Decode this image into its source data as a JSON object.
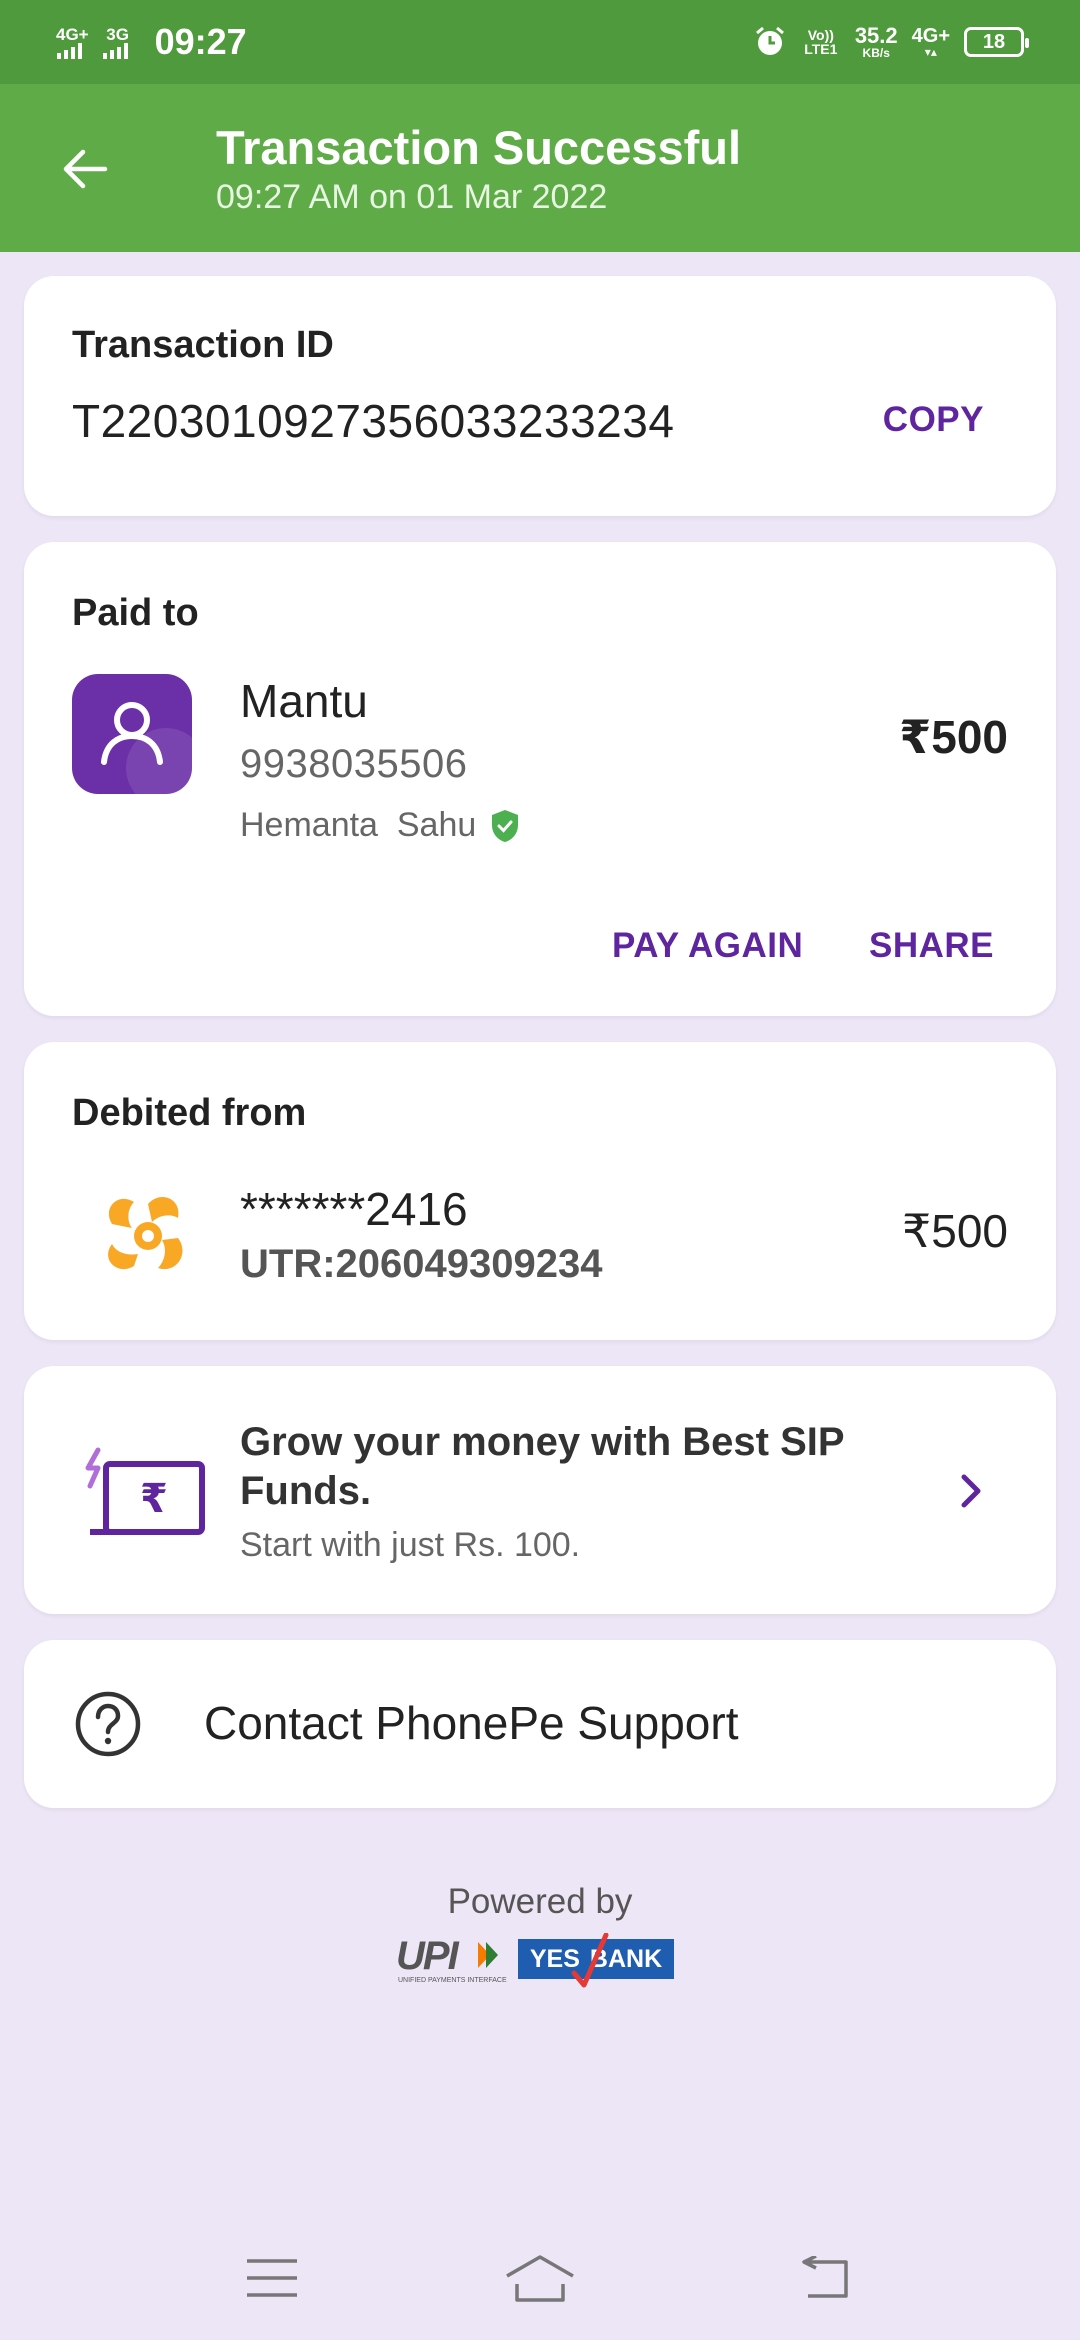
{
  "status_bar": {
    "network_1": "4G+",
    "network_2": "3G",
    "time": "09:27",
    "volte": "Vo)) LTE1",
    "speed": "35.2",
    "speed_unit": "KB/s",
    "network_3": "4G+",
    "battery": "18"
  },
  "app_bar": {
    "title": "Transaction Successful",
    "subtitle": "09:27 AM on 01 Mar 2022",
    "accent": "#5fab47"
  },
  "transaction": {
    "label": "Transaction ID",
    "id": "T2203010927356033233234",
    "copy_label": "COPY"
  },
  "paid_to": {
    "label": "Paid to",
    "name": "Mantu",
    "phone": "9938035506",
    "full_name": "Hemanta  Sahu",
    "amount": "₹500",
    "pay_again_label": "PAY AGAIN",
    "share_label": "SHARE",
    "avatar_icon": "person-icon",
    "verified_icon": "verified-shield-icon"
  },
  "debited_from": {
    "label": "Debited from",
    "account": "*******2416",
    "utr": "UTR:206049309234",
    "amount": "₹500",
    "bank_icon": "icici-bank-logo"
  },
  "sip_promo": {
    "title": "Grow your money with Best SIP Funds.",
    "subtitle": "Start with just Rs. 100.",
    "icon": "rupee-card-icon"
  },
  "support": {
    "label": "Contact PhonePe Support",
    "icon": "help-circle-icon"
  },
  "footer": {
    "powered_by": "Powered by",
    "upi_text": "UPI",
    "upi_tagline": "UNIFIED PAYMENTS INTERFACE",
    "bank_left": "YES",
    "bank_right": "BANK"
  },
  "colors": {
    "brand_purple": "#5f259f",
    "status_green": "#4f9a3c",
    "background": "#ede6f6"
  }
}
